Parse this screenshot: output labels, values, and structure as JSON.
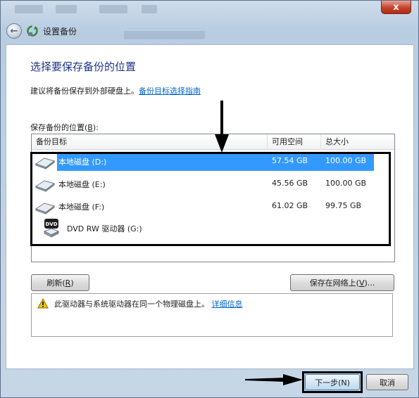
{
  "window": {
    "close_label": "x",
    "nav_title": "设置备份",
    "back_icon": "back-arrow-icon",
    "app_icon": "backup-icon"
  },
  "main": {
    "heading": "选择要保存备份的位置",
    "advice_text": "建议将备份保存到外部硬盘上。",
    "advice_link": "备份目标选择指南",
    "location_label_prefix": "保存备份的位置(",
    "location_label_key": "B",
    "location_label_suffix": "):"
  },
  "list": {
    "columns": [
      "备份目标",
      "可用空间",
      "总大小"
    ],
    "rows": [
      {
        "name": "本地磁盘 (D:)",
        "free": "57.54 GB",
        "total": "100.00 GB",
        "icon": "hard-drive-icon",
        "selected": true
      },
      {
        "name": "本地磁盘 (E:)",
        "free": "45.56 GB",
        "total": "100.00 GB",
        "icon": "hard-drive-icon",
        "selected": false
      },
      {
        "name": "本地磁盘 (F:)",
        "free": "61.02 GB",
        "total": "99.75 GB",
        "icon": "hard-drive-icon",
        "selected": false
      },
      {
        "name": "DVD RW 驱动器 (G:)",
        "free": "",
        "total": "",
        "icon": "dvd-drive-icon",
        "selected": false
      }
    ],
    "dvd_badge": "DVD"
  },
  "buttons": {
    "refresh_prefix": "刷新(",
    "refresh_key": "R",
    "refresh_suffix": ")",
    "network_prefix": "保存在网络上(",
    "network_key": "V",
    "network_suffix": ")...",
    "next_label": "下一步(N)",
    "cancel_label": "取消"
  },
  "warning": {
    "text": "此驱动器与系统驱动器在同一个物理磁盘上。",
    "link": "详细信息",
    "icon": "warning-icon"
  },
  "colors": {
    "heading": "#1e3287",
    "link": "#0066cc",
    "selection": "#3399ff"
  }
}
